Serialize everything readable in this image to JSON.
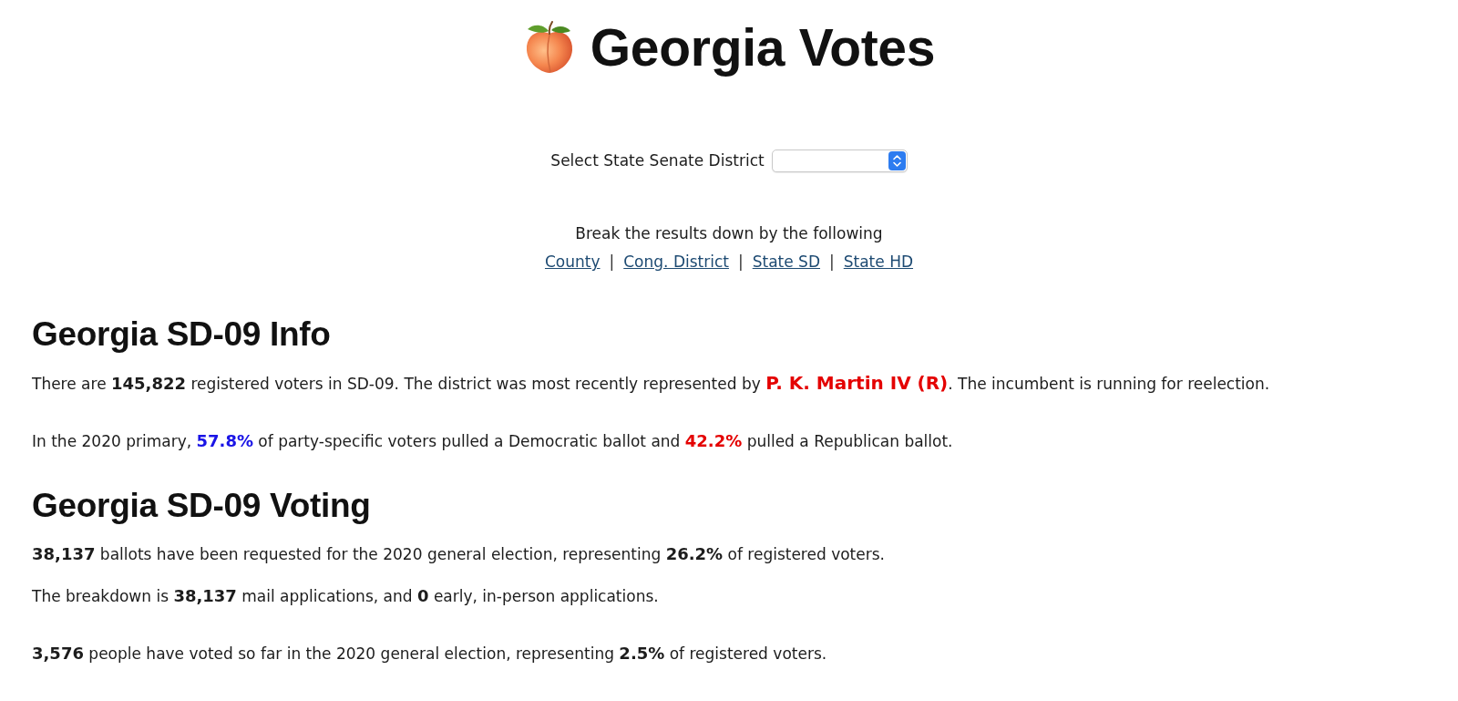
{
  "header": {
    "title": "Georgia Votes"
  },
  "district_select": {
    "label": "Select State Senate District"
  },
  "breakdown": {
    "prompt": "Break the results down by the following",
    "items": [
      {
        "kind": "link",
        "text": "County"
      },
      {
        "kind": "separator",
        "text": "|"
      },
      {
        "kind": "link",
        "text": "Cong. District"
      },
      {
        "kind": "separator",
        "text": "|"
      },
      {
        "kind": "link",
        "text": "State SD"
      },
      {
        "kind": "separator",
        "text": "|"
      },
      {
        "kind": "link",
        "text": "State HD"
      }
    ]
  },
  "sections": [
    {
      "heading": "Georgia SD-09 Info",
      "paragraphs": [
        {
          "lines": [
            [
              {
                "kind": "plain",
                "text": "There are "
              },
              {
                "kind": "number",
                "text": "145,822"
              },
              {
                "kind": "plain",
                "text": " registered voters in SD-09. The district was most recently represented by "
              },
              {
                "kind": "candidate",
                "text": "P. K. Martin IV (R)",
                "color": "#e40000"
              },
              {
                "kind": "plain",
                "text": ". The incumbent is running for reelection."
              }
            ]
          ]
        },
        {
          "lines": [
            [
              {
                "kind": "plain",
                "text": "In the 2020 primary, "
              },
              {
                "kind": "number",
                "text": "57.8%",
                "color": "#1a14e6"
              },
              {
                "kind": "plain",
                "text": " of party-specific voters pulled a Democratic ballot and "
              },
              {
                "kind": "number",
                "text": "42.2%",
                "color": "#e40000"
              },
              {
                "kind": "plain",
                "text": " pulled a Republican ballot."
              }
            ]
          ]
        }
      ]
    },
    {
      "heading": "Georgia SD-09 Voting",
      "paragraphs": [
        {
          "lines": [
            [
              {
                "kind": "number",
                "text": "38,137"
              },
              {
                "kind": "plain",
                "text": " ballots have been requested for the 2020 general election, representing "
              },
              {
                "kind": "number",
                "text": "26.2%"
              },
              {
                "kind": "plain",
                "text": " of registered voters."
              }
            ],
            [
              {
                "kind": "plain",
                "text": "The breakdown is "
              },
              {
                "kind": "number",
                "text": "38,137"
              },
              {
                "kind": "plain",
                "text": " mail applications, and "
              },
              {
                "kind": "number",
                "text": "0"
              },
              {
                "kind": "plain",
                "text": " early, in-person applications."
              }
            ]
          ]
        },
        {
          "lines": [
            [
              {
                "kind": "number",
                "text": "3,576"
              },
              {
                "kind": "plain",
                "text": " people have voted so far in the 2020 general election, representing "
              },
              {
                "kind": "number",
                "text": "2.5%"
              },
              {
                "kind": "plain",
                "text": " of registered voters."
              }
            ]
          ]
        }
      ]
    }
  ]
}
